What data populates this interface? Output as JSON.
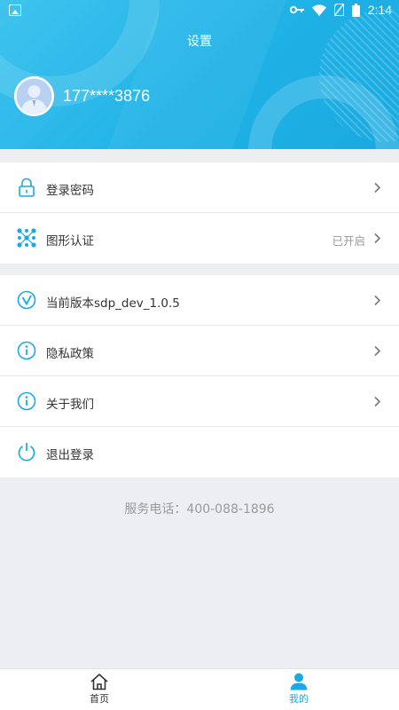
{
  "status_bar": {
    "time": "2:14"
  },
  "header": {
    "title": "设置",
    "phone": "177****3876"
  },
  "security_group": [
    {
      "label": "登录密码",
      "value": "",
      "icon": "lock-icon"
    },
    {
      "label": "图形认证",
      "value": "已开启",
      "icon": "pattern-icon"
    }
  ],
  "about_group": [
    {
      "label": "当前版本sdp_dev_1.0.5",
      "icon": "version-icon"
    },
    {
      "label": "隐私政策",
      "icon": "info-icon"
    },
    {
      "label": "关于我们",
      "icon": "info-icon"
    },
    {
      "label": "退出登录",
      "icon": "power-icon"
    }
  ],
  "service_phone": "服务电话：400-088-1896",
  "tabbar": {
    "home_label": "首页",
    "mine_label": "我的"
  },
  "colors": {
    "accent": "#1aa9e6",
    "header_start": "#3fc3ee",
    "header_end": "#1aa9e0"
  }
}
